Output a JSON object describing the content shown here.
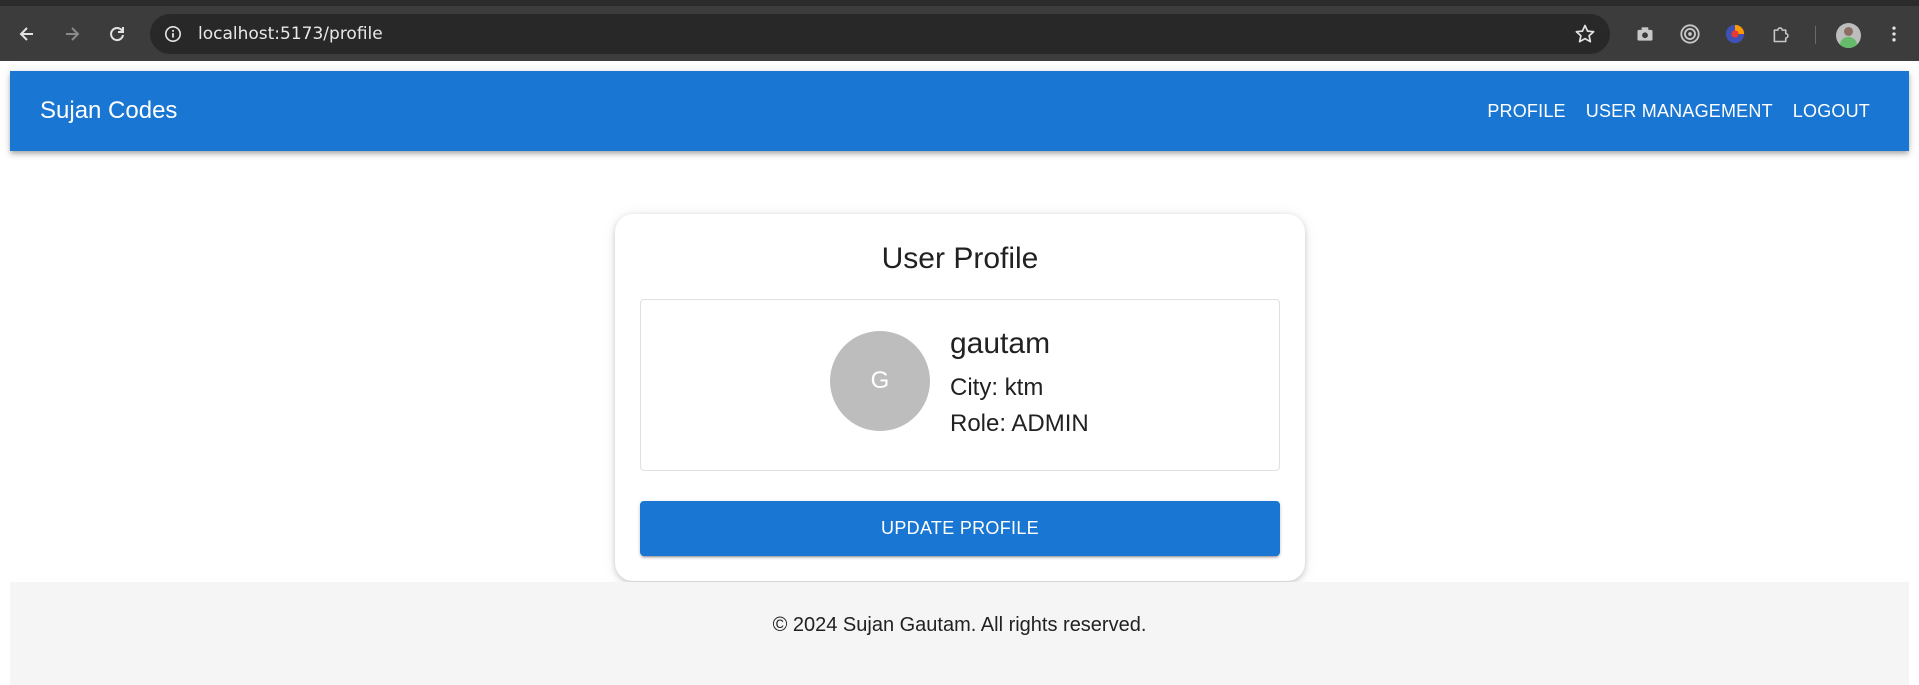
{
  "browser": {
    "url": "localhost:5173/profile",
    "icons": [
      "back-icon",
      "forward-icon",
      "reload-icon",
      "site-info-icon",
      "bookmark-star-icon",
      "camera-extension-icon",
      "target-extension-icon",
      "colorful-extension-icon",
      "puzzle-extensions-icon",
      "profile-avatar-icon",
      "more-menu-icon"
    ]
  },
  "header": {
    "brand": "Sujan Codes",
    "nav": [
      "PROFILE",
      "USER MANAGEMENT",
      "LOGOUT"
    ]
  },
  "card": {
    "title": "User Profile",
    "avatar_letter": "G",
    "username": "gautam",
    "city": "City: ktm",
    "role": "Role: ADMIN",
    "button": "UPDATE PROFILE"
  },
  "footer": {
    "text": "© 2024 Sujan Gautam. All rights reserved."
  },
  "colors": {
    "primary": "#1976d2",
    "avatar_bg": "#bdbdbd",
    "footer_bg": "#f5f5f5"
  }
}
